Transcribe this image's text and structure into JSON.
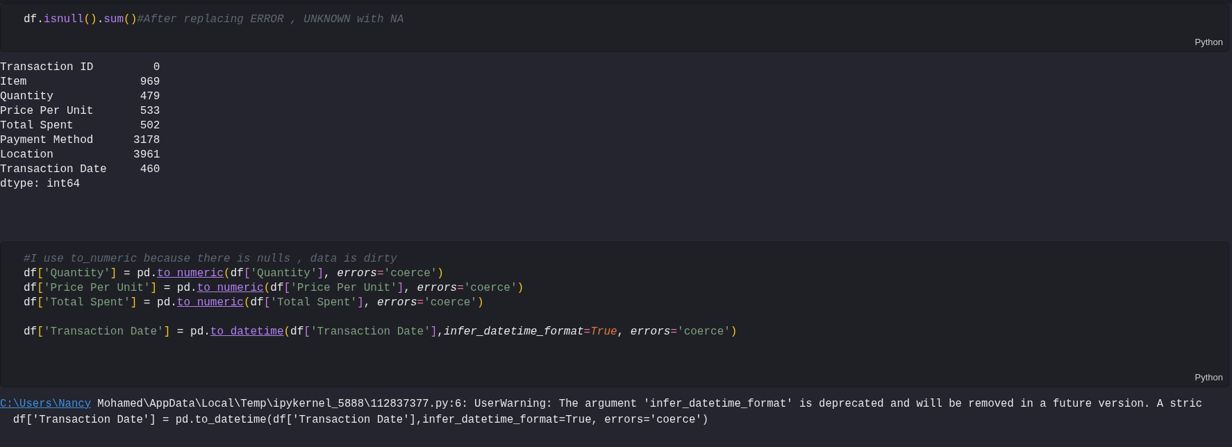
{
  "cells": [
    {
      "kind": "code",
      "language": "Python",
      "lines": [
        {
          "kind": "code",
          "tokens": [
            {
              "kind": "plain",
              "text": "df."
            },
            {
              "kind": "func",
              "text": "isnull"
            },
            {
              "kind": "b1",
              "text": "()"
            },
            {
              "kind": "plain",
              "text": "."
            },
            {
              "kind": "func",
              "text": "sum"
            },
            {
              "kind": "b1",
              "text": "()"
            },
            {
              "kind": "comment",
              "text": "#After replacing ERROR , UNKNOWN with NA"
            }
          ]
        }
      ]
    },
    {
      "kind": "output",
      "lines": [
        {
          "text": "Transaction ID         0"
        },
        {
          "text": "Item                 969"
        },
        {
          "text": "Quantity             479"
        },
        {
          "text": "Price Per Unit       533"
        },
        {
          "text": "Total Spent          502"
        },
        {
          "text": "Payment Method      3178"
        },
        {
          "text": "Location            3961"
        },
        {
          "text": "Transaction Date     460"
        },
        {
          "text": "dtype: int64"
        }
      ]
    },
    {
      "kind": "code",
      "language": "Python",
      "lines": [
        {
          "kind": "code",
          "tokens": [
            {
              "kind": "comment",
              "text": "#I use to_numeric because there is nulls , data is dirty"
            }
          ]
        },
        {
          "kind": "code",
          "tokens": [
            {
              "kind": "plain",
              "text": "df"
            },
            {
              "kind": "b1",
              "text": "["
            },
            {
              "kind": "string",
              "text": "'Quantity'"
            },
            {
              "kind": "b1",
              "text": "]"
            },
            {
              "kind": "plain",
              "text": " = pd."
            },
            {
              "kind": "funcu",
              "text": "to_numeric"
            },
            {
              "kind": "b1",
              "text": "("
            },
            {
              "kind": "plain",
              "text": "df"
            },
            {
              "kind": "b2",
              "text": "["
            },
            {
              "kind": "string",
              "text": "'Quantity'"
            },
            {
              "kind": "b2",
              "text": "]"
            },
            {
              "kind": "plain",
              "text": ", "
            },
            {
              "kind": "param",
              "text": "errors"
            },
            {
              "kind": "op",
              "text": "="
            },
            {
              "kind": "string",
              "text": "'coerce'"
            },
            {
              "kind": "b1",
              "text": ")"
            }
          ]
        },
        {
          "kind": "code",
          "tokens": [
            {
              "kind": "plain",
              "text": "df"
            },
            {
              "kind": "b1",
              "text": "["
            },
            {
              "kind": "string",
              "text": "'Price Per Unit'"
            },
            {
              "kind": "b1",
              "text": "]"
            },
            {
              "kind": "plain",
              "text": " = pd."
            },
            {
              "kind": "funcu",
              "text": "to_numeric"
            },
            {
              "kind": "b1",
              "text": "("
            },
            {
              "kind": "plain",
              "text": "df"
            },
            {
              "kind": "b2",
              "text": "["
            },
            {
              "kind": "string",
              "text": "'Price Per Unit'"
            },
            {
              "kind": "b2",
              "text": "]"
            },
            {
              "kind": "plain",
              "text": ", "
            },
            {
              "kind": "param",
              "text": "errors"
            },
            {
              "kind": "op",
              "text": "="
            },
            {
              "kind": "string",
              "text": "'coerce'"
            },
            {
              "kind": "b1",
              "text": ")"
            }
          ]
        },
        {
          "kind": "code",
          "tokens": [
            {
              "kind": "plain",
              "text": "df"
            },
            {
              "kind": "b1",
              "text": "["
            },
            {
              "kind": "string",
              "text": "'Total Spent'"
            },
            {
              "kind": "b1",
              "text": "]"
            },
            {
              "kind": "plain",
              "text": " = pd."
            },
            {
              "kind": "funcu",
              "text": "to_numeric"
            },
            {
              "kind": "b1",
              "text": "("
            },
            {
              "kind": "plain",
              "text": "df"
            },
            {
              "kind": "b2",
              "text": "["
            },
            {
              "kind": "string",
              "text": "'Total Spent'"
            },
            {
              "kind": "b2",
              "text": "]"
            },
            {
              "kind": "plain",
              "text": ", "
            },
            {
              "kind": "param",
              "text": "errors"
            },
            {
              "kind": "op",
              "text": "="
            },
            {
              "kind": "string",
              "text": "'coerce'"
            },
            {
              "kind": "b1",
              "text": ")"
            }
          ]
        },
        {
          "kind": "blank"
        },
        {
          "kind": "code",
          "tokens": [
            {
              "kind": "plain",
              "text": "df"
            },
            {
              "kind": "b1",
              "text": "["
            },
            {
              "kind": "string",
              "text": "'Transaction Date'"
            },
            {
              "kind": "b1",
              "text": "]"
            },
            {
              "kind": "plain",
              "text": " = pd."
            },
            {
              "kind": "funcu",
              "text": "to_datetime"
            },
            {
              "kind": "b1",
              "text": "("
            },
            {
              "kind": "plain",
              "text": "df"
            },
            {
              "kind": "b2",
              "text": "["
            },
            {
              "kind": "string",
              "text": "'Transaction Date'"
            },
            {
              "kind": "b2",
              "text": "]"
            },
            {
              "kind": "plain",
              "text": ","
            },
            {
              "kind": "param",
              "text": "infer_datetime_format"
            },
            {
              "kind": "op",
              "text": "="
            },
            {
              "kind": "keyword",
              "text": "True"
            },
            {
              "kind": "plain",
              "text": ", "
            },
            {
              "kind": "param",
              "text": "errors"
            },
            {
              "kind": "op",
              "text": "="
            },
            {
              "kind": "string",
              "text": "'coerce'"
            },
            {
              "kind": "b1",
              "text": ")"
            }
          ]
        }
      ]
    },
    {
      "kind": "warning",
      "lines": [
        {
          "link": "C:\\Users\\Nancy",
          "text": " Mohamed\\AppData\\Local\\Temp\\ipykernel_5888\\112837377.py:6: UserWarning: The argument 'infer_datetime_format' is deprecated and will be removed in a future version. A stric"
        },
        {
          "text": "  df['Transaction Date'] = pd.to_datetime(df['Transaction Date'],infer_datetime_format=True, errors='coerce')"
        }
      ]
    }
  ]
}
